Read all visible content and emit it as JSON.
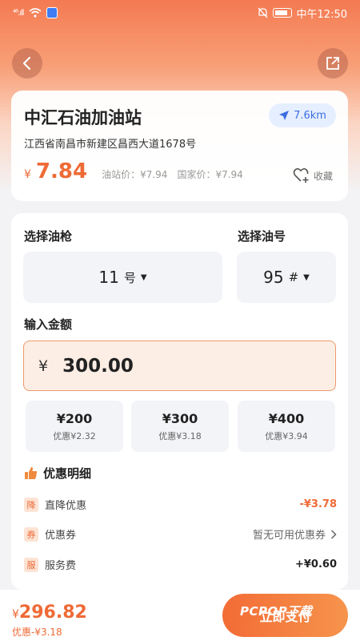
{
  "status_bar": {
    "signal": "⁴⁶.ıll",
    "time": "中午12:50"
  },
  "station": {
    "name": "中汇石油加油站",
    "distance": "7.6km",
    "address": "江西省南昌市新建区昌西大道1678号",
    "currency": "¥",
    "price": "7.84",
    "station_price": "油站价：¥7.94",
    "national_price": "国家价：¥7.94",
    "favorite_label": "收藏"
  },
  "selection": {
    "gun_label": "选择油枪",
    "gun_value": "11",
    "gun_unit": "号",
    "fuel_label": "选择油号",
    "fuel_value": "95",
    "fuel_unit": "#"
  },
  "amount": {
    "label": "输入金额",
    "symbol": "¥",
    "value": "300.00"
  },
  "quick_amounts": [
    {
      "amount": "¥200",
      "discount": "优惠¥2.32"
    },
    {
      "amount": "¥300",
      "discount": "优惠¥3.18"
    },
    {
      "amount": "¥400",
      "discount": "优惠¥3.94"
    }
  ],
  "discounts": {
    "title": "优惠明细",
    "rows": [
      {
        "tag": "降",
        "label": "直降优惠",
        "value": "-¥3.78"
      },
      {
        "tag": "券",
        "label": "优惠券",
        "value": "暂无可用优惠券"
      },
      {
        "tag": "服",
        "label": "服务费",
        "value": "+¥0.60"
      }
    ]
  },
  "footer": {
    "total_symbol": "¥",
    "total": "296.82",
    "total_discount": "优惠-¥3.18",
    "pay_label": "立即支付",
    "watermark": "PCPOP下载"
  },
  "colors": {
    "accent": "#ef6a36",
    "blue": "#3b6fe0",
    "header_gradient_top": "#f47a52"
  },
  "icons": [
    "back-icon",
    "share-icon",
    "navigate-icon",
    "heart-plus-icon",
    "thumb-up-icon",
    "chevron-right-icon",
    "caret-down-icon"
  ]
}
